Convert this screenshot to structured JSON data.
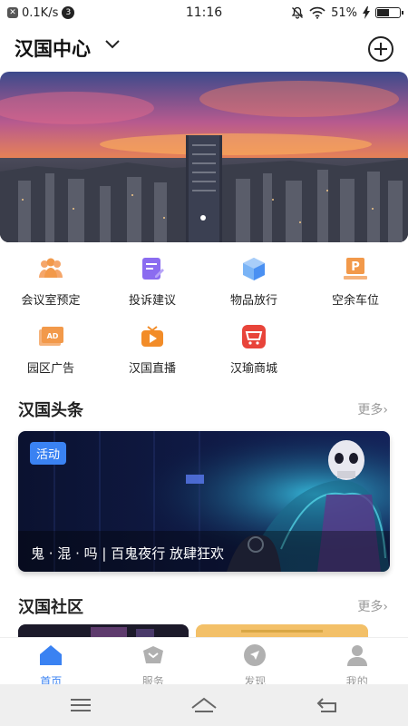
{
  "status_bar": {
    "network_speed": "0.1K/s",
    "notification_count": "3",
    "time": "11:16",
    "battery_percent": "51%",
    "battery_level": 0.51
  },
  "header": {
    "title": "汉国中心"
  },
  "banner": {
    "slide_count": 1
  },
  "quick_actions": [
    {
      "label": "会议室预定",
      "icon": "meeting-room-icon",
      "color": "#f2994a"
    },
    {
      "label": "投诉建议",
      "icon": "complaint-edit-icon",
      "color": "#8b6cf0"
    },
    {
      "label": "物品放行",
      "icon": "package-box-icon",
      "color": "#4a90f2"
    },
    {
      "label": "空余车位",
      "icon": "parking-icon",
      "color": "#f2994a"
    },
    {
      "label": "园区广告",
      "icon": "ad-board-icon",
      "color": "#f2994a"
    },
    {
      "label": "汉国直播",
      "icon": "live-tv-icon",
      "color": "#f28c28"
    },
    {
      "label": "汉瑜商城",
      "icon": "shop-icon",
      "color": "#e8443a"
    }
  ],
  "headlines": {
    "title": "汉国头条",
    "more": "更多",
    "card": {
      "tag": "活动",
      "text": "鬼 · 混 · 吗 | 百鬼夜行 放肆狂欢"
    }
  },
  "community": {
    "title": "汉国社区",
    "more": "更多"
  },
  "tabbar": {
    "tabs": [
      {
        "label": "首页",
        "icon": "home-icon",
        "active": true
      },
      {
        "label": "服务",
        "icon": "service-icon",
        "active": false
      },
      {
        "label": "发现",
        "icon": "discover-icon",
        "active": false
      },
      {
        "label": "我的",
        "icon": "profile-icon",
        "active": false
      }
    ]
  },
  "colors": {
    "accent": "#3a82f2",
    "inactive": "#b0b0b0"
  }
}
